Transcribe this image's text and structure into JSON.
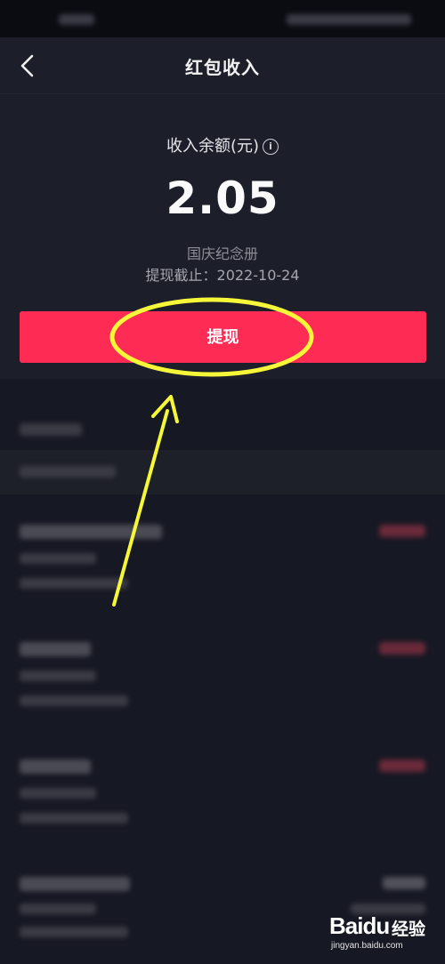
{
  "header": {
    "title": "红包收入"
  },
  "summary": {
    "balance_label": "收入余额(元)",
    "balance_amount": "2.05",
    "event_name": "国庆纪念册",
    "deadline_label": "提现截止：",
    "deadline_date": "2022-10-24"
  },
  "actions": {
    "withdraw_label": "提现"
  },
  "icons": {
    "back": "chevron-left-icon",
    "info": "info-icon"
  },
  "colors": {
    "accent": "#fe2c55",
    "annotation": "#f7f73a",
    "background": "#161823"
  },
  "watermark": {
    "brand": "Bai",
    "brand_tail": "经验",
    "url": "jingyan.baidu.com"
  }
}
